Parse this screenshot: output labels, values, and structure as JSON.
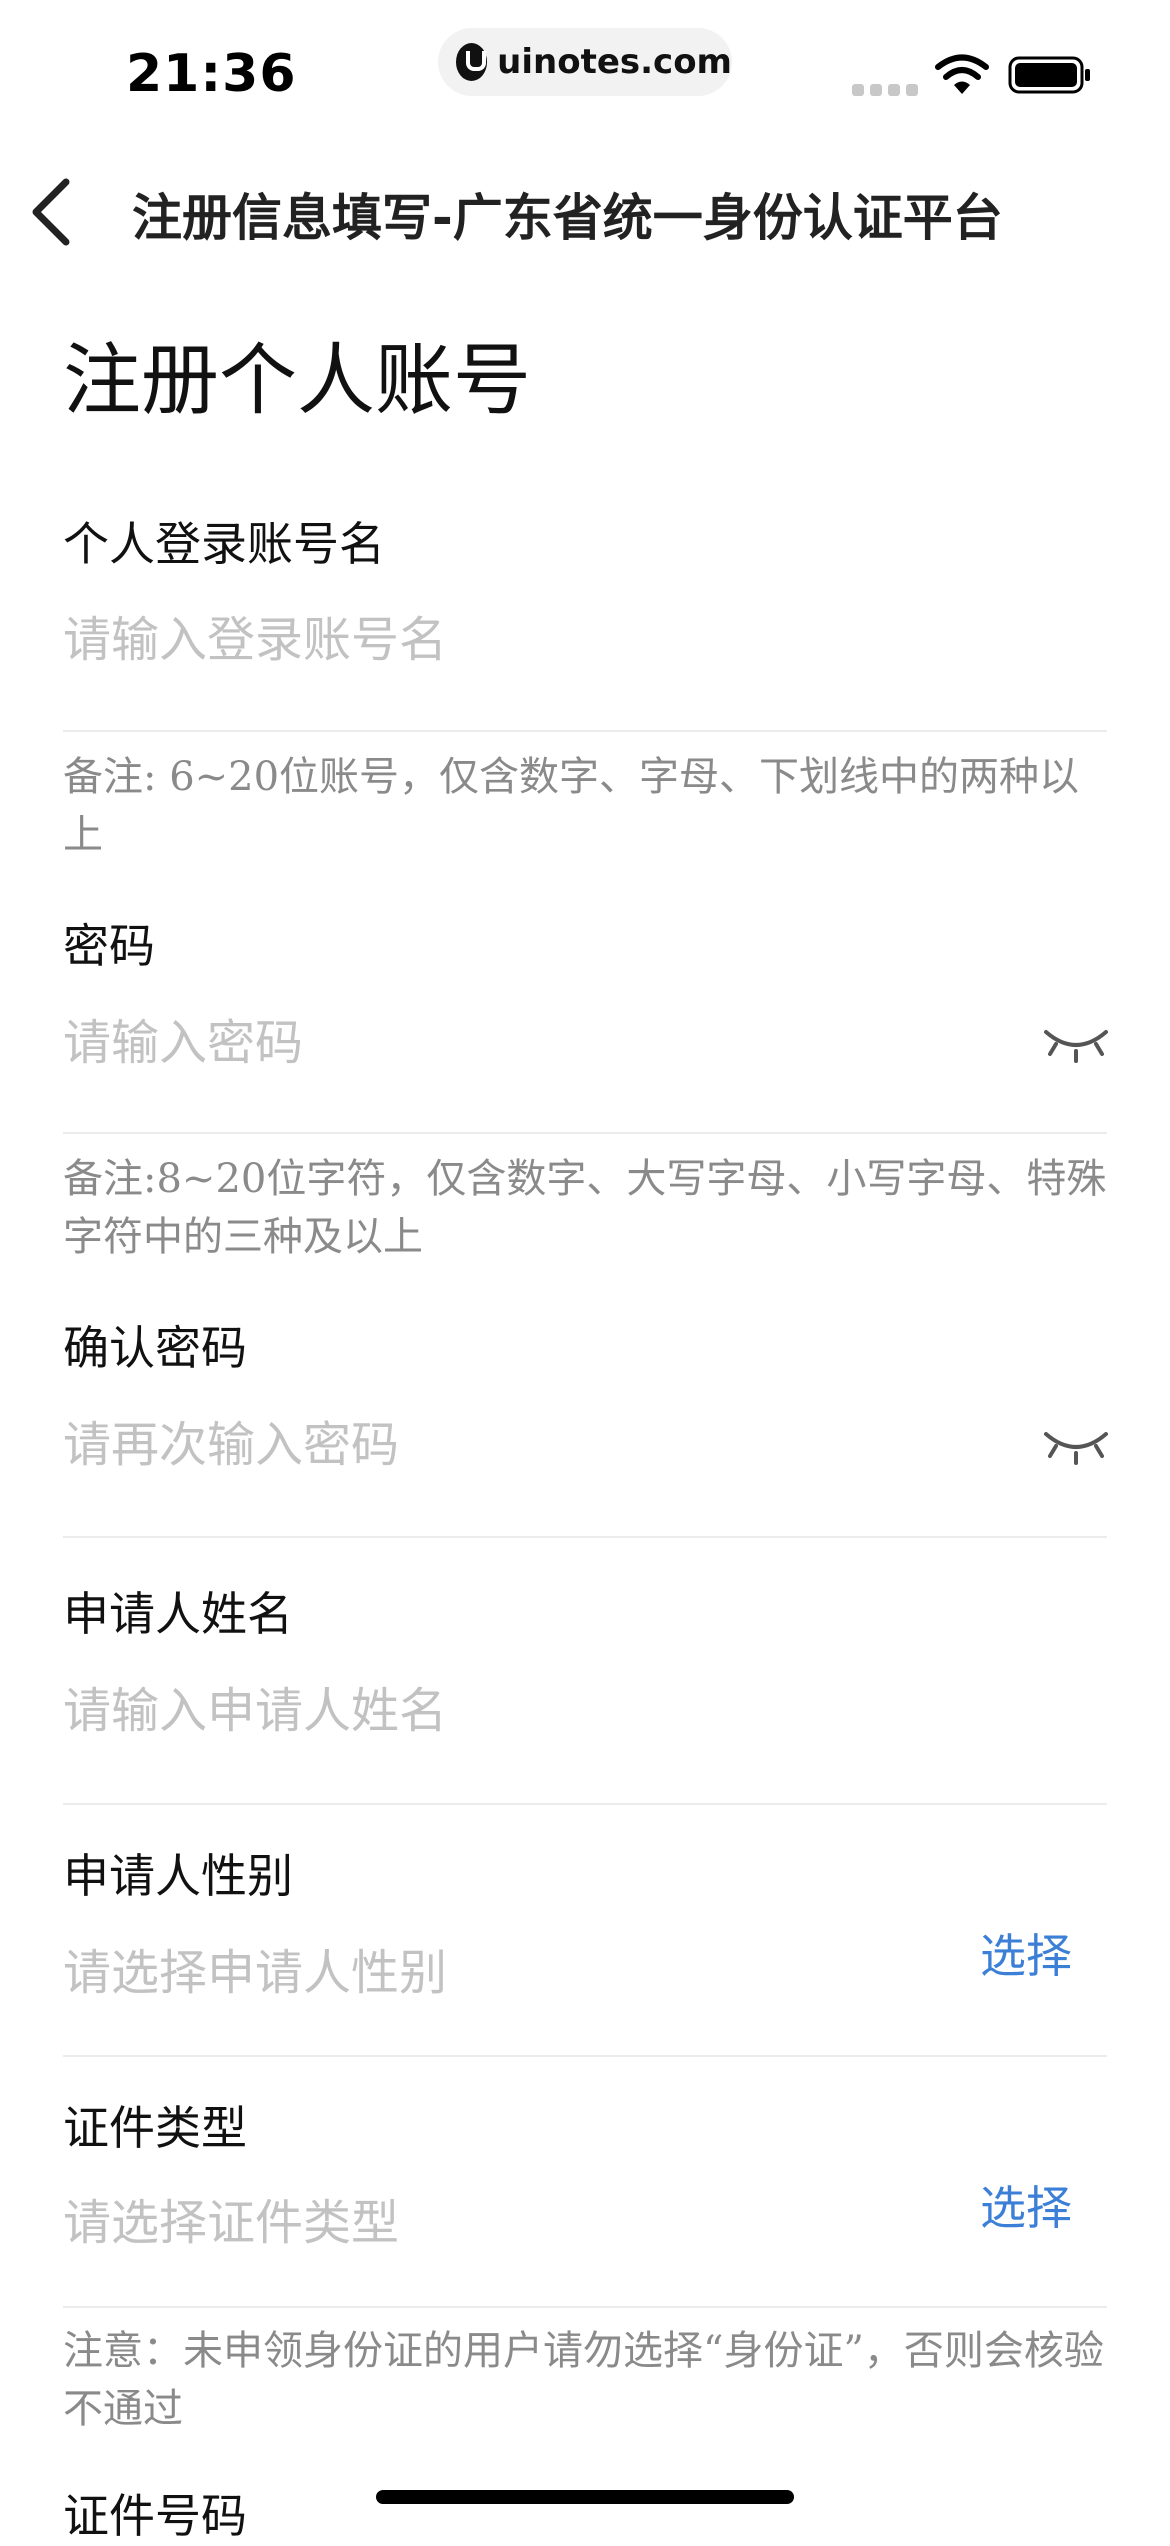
{
  "status_bar": {
    "time": "21:36",
    "url": "uinotes.com"
  },
  "nav": {
    "title": "注册信息填写-广东省统一身份认证平台"
  },
  "page": {
    "title": "注册个人账号"
  },
  "fields": {
    "account": {
      "label": "个人登录账号名",
      "placeholder": "请输入登录账号名",
      "note": "备注: 6~20位账号，仅含数字、字母、下划线中的两种以上"
    },
    "password": {
      "label": "密码",
      "placeholder": "请输入密码",
      "note": "备注:8~20位字符，仅含数字、大写字母、小写字母、特殊字符中的三种及以上"
    },
    "confirm_password": {
      "label": "确认密码",
      "placeholder": "请再次输入密码"
    },
    "name": {
      "label": "申请人姓名",
      "placeholder": "请输入申请人姓名"
    },
    "gender": {
      "label": "申请人性别",
      "placeholder": "请选择申请人性别",
      "select_label": "选择"
    },
    "id_type": {
      "label": "证件类型",
      "placeholder": "请选择证件类型",
      "select_label": "选择",
      "note": "注意：未申领身份证的用户请勿选择“身份证”，否则会核验不通过"
    },
    "id_number": {
      "label": "证件号码"
    }
  },
  "icons": {
    "back": "chevron-left-icon",
    "password_toggle": "eye-closed-icon",
    "wifi": "wifi-icon",
    "battery": "battery-icon"
  },
  "colors": {
    "accent": "#3c7fd6",
    "placeholder": "#c2c2c2",
    "note": "#8a8a8a",
    "divider": "#ececec"
  }
}
